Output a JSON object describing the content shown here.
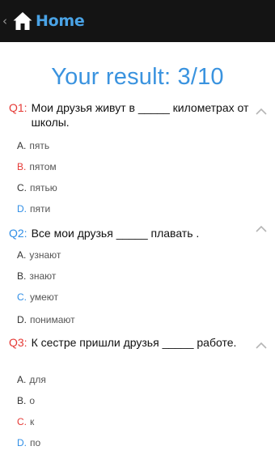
{
  "header": {
    "back_glyph": "‹",
    "home_icon": "home-icon",
    "title": "Home",
    "title_color": "#4aa3e6",
    "bar_color": "#141414"
  },
  "result": {
    "text": "Your result: 3/10",
    "color": "#3a93df"
  },
  "colors": {
    "wrong": "#e53935",
    "correct": "#2f8ee6",
    "neutral": "#333333"
  },
  "questions": [
    {
      "label": "Q1:",
      "label_status": "wrong",
      "text": "Мои друзья живут в _____ километрах от школы.",
      "collapse_icon": "chevron-up-icon",
      "options": [
        {
          "letter": "A.",
          "text": "пять",
          "status": "neutral"
        },
        {
          "letter": "B.",
          "text": "пятом",
          "status": "wrong"
        },
        {
          "letter": "C.",
          "text": "пятью",
          "status": "neutral"
        },
        {
          "letter": "D.",
          "text": "пяти",
          "status": "correct"
        }
      ]
    },
    {
      "label": "Q2:",
      "label_status": "correct",
      "text": "Все мои друзья _____ плавать .",
      "collapse_icon": "chevron-up-icon",
      "options": [
        {
          "letter": "A.",
          "text": "узнают",
          "status": "neutral"
        },
        {
          "letter": "B.",
          "text": "знают",
          "status": "neutral"
        },
        {
          "letter": "C.",
          "text": "умеют",
          "status": "correct"
        },
        {
          "letter": "D.",
          "text": "понимают",
          "status": "neutral"
        }
      ]
    },
    {
      "label": "Q3:",
      "label_status": "wrong",
      "text": "К сестре пришли друзья _____ работе.",
      "collapse_icon": "chevron-up-icon",
      "options": [
        {
          "letter": "A.",
          "text": "для",
          "status": "neutral"
        },
        {
          "letter": "B.",
          "text": "о",
          "status": "neutral"
        },
        {
          "letter": "C.",
          "text": "к",
          "status": "wrong"
        },
        {
          "letter": "D.",
          "text": "по",
          "status": "correct"
        }
      ]
    }
  ]
}
